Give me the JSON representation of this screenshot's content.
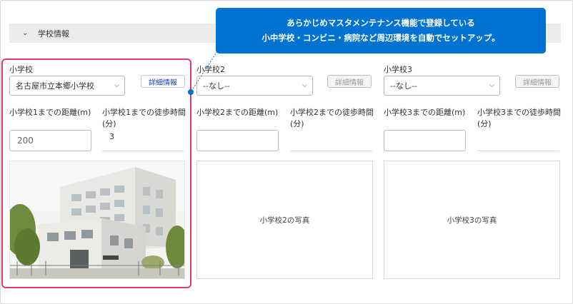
{
  "section": {
    "title": "学校情報"
  },
  "callout": {
    "line1": "あらかじめマスタメンテナンス機能で登録している",
    "line2": "小中学校・コンビニ・病院など周辺環境を自動でセットアップ。"
  },
  "schools": [
    {
      "label": "小学校",
      "select_value": "名古屋市立本郷小学校",
      "detail_label": "詳細情報",
      "distance_label": "小学校1までの距離(m)",
      "distance_value": "200",
      "walk_label": "小学校1までの徒歩時間(分)",
      "walk_value": "3"
    },
    {
      "label": "小学校2",
      "select_value": "--なし--",
      "detail_label": "詳細情報",
      "distance_label": "小学校2までの距離(m)",
      "distance_value": "",
      "walk_label": "小学校2までの徒歩時間(分)",
      "walk_value": "",
      "photo_label": "小学校2の写真"
    },
    {
      "label": "小学校3",
      "select_value": "--なし--",
      "detail_label": "詳細情報",
      "distance_label": "小学校3までの距離(m)",
      "distance_value": "",
      "walk_label": "小学校3までの徒歩時間(分)",
      "walk_value": "",
      "photo_label": "小学校3の写真"
    }
  ],
  "colors": {
    "callout": "#0072d2",
    "highlight": "#e3396a",
    "link": "#1a3fb5"
  },
  "icons": {
    "section_toggle": "chevron-down-icon",
    "select_arrow": "chevron-down-icon"
  }
}
